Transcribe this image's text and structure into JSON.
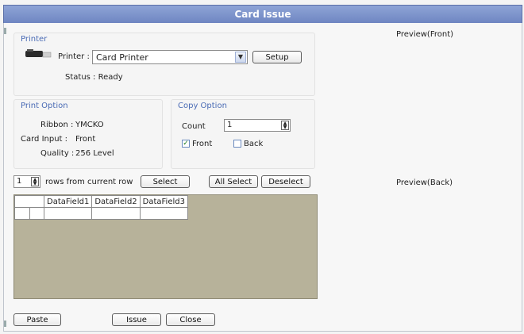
{
  "window": {
    "title": "Card Issue"
  },
  "printer_group": {
    "title": "Printer",
    "printer_label": "Printer :",
    "printer_value": "Card Printer",
    "setup_label": "Setup",
    "status_text": "Status : Ready"
  },
  "print_option": {
    "title": "Print Option",
    "ribbon_label": "Ribbon :",
    "ribbon_value": "YMCKO",
    "card_input_label": "Card Input :",
    "card_input_value": "Front",
    "quality_label": "Quality :",
    "quality_value": "256 Level"
  },
  "copy_option": {
    "title": "Copy Option",
    "count_label": "Count",
    "count_value": "1",
    "front_label": "Front",
    "front_checked": true,
    "back_label": "Back",
    "back_checked": false
  },
  "rows": {
    "spin_value": "1",
    "rows_label": "rows from current row",
    "select_label": "Select",
    "all_select_label": "All Select",
    "deselect_label": "Deselect"
  },
  "grid": {
    "columns": [
      "DataField1",
      "DataField2",
      "DataField3"
    ]
  },
  "preview": {
    "front_label": "Preview(Front)",
    "back_label": "Preview(Back)"
  },
  "footer": {
    "paste_label": "Paste",
    "issue_label": "Issue",
    "close_label": "Close"
  }
}
